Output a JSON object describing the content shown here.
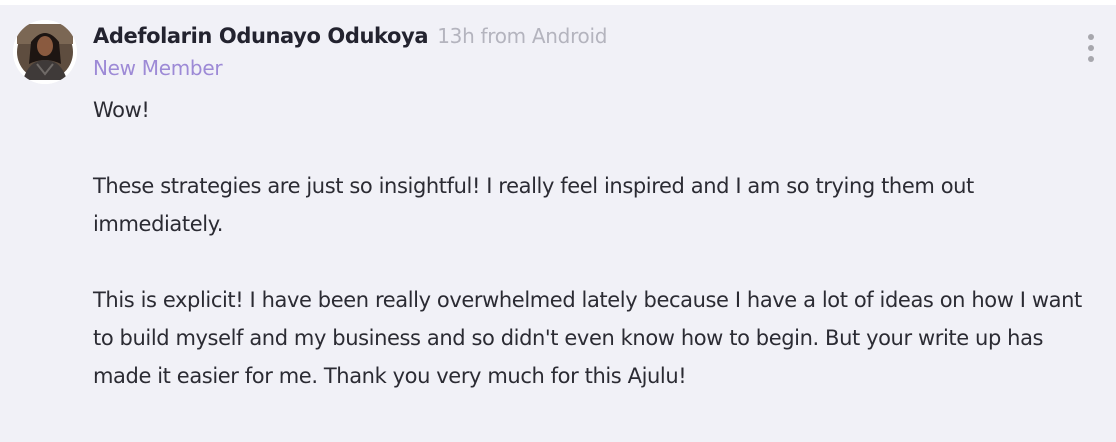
{
  "post": {
    "author_name": "Adefolarin Odunayo Odukoya",
    "meta": "13h from Android",
    "role": "New Member",
    "paragraphs": [
      "Wow!",
      "These strategies are just so insightful! I really feel inspired and I am so trying them out immediately.",
      "This is explicit! I have been really overwhelmed lately because I have a lot of ideas on how I want to build myself and my business and so didn't even know how to begin. But your write up has made it easier for me. Thank you very much for this Ajulu!"
    ]
  },
  "icons": {
    "menu": "more-vertical-icon",
    "avatar": "user-avatar"
  },
  "colors": {
    "card_background": "#f1f1f7",
    "author_name": "#23232f",
    "meta_text": "#b4b4be",
    "role_text": "#9d8ad6",
    "body_text": "#2b2b33"
  }
}
